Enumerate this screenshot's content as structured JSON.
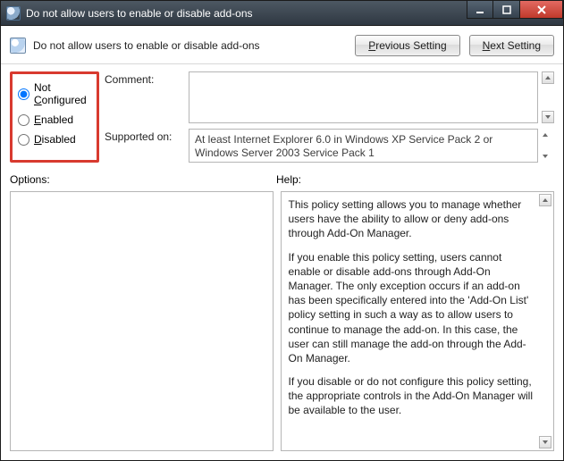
{
  "titlebar": {
    "title": "Do not allow users to enable or disable add-ons"
  },
  "header": {
    "heading": "Do not allow users to enable or disable add-ons",
    "prev_prefix": "P",
    "prev_rest": "revious Setting",
    "next_prefix": "N",
    "next_rest": "ext Setting"
  },
  "state": {
    "options": {
      "not_configured": "Not ",
      "not_configured_ul": "C",
      "not_configured_rest": "onfigured",
      "enabled_ul": "E",
      "enabled_rest": "nabled",
      "disabled_ul": "D",
      "disabled_rest": "isabled"
    },
    "selected": "not_configured"
  },
  "labels": {
    "comment": "Comment:",
    "supported_on": "Supported on:",
    "options": "Options:",
    "help": "Help:"
  },
  "comment": "",
  "supported_on": "At least Internet Explorer 6.0 in Windows XP Service Pack 2 or Windows Server 2003 Service Pack 1",
  "options_body": "",
  "help": {
    "p1": "This policy setting allows you to manage whether users have the ability to allow or deny add-ons through Add-On Manager.",
    "p2": "If you enable this policy setting, users cannot enable or disable add-ons through Add-On Manager. The only exception occurs if an add-on has been specifically entered into the 'Add-On List' policy setting in such a way as to allow users to continue to manage the add-on. In this case, the user can still manage the add-on through the Add-On Manager.",
    "p3": "If you disable or do not configure this policy setting, the appropriate controls in the Add-On Manager will be available to the user."
  }
}
